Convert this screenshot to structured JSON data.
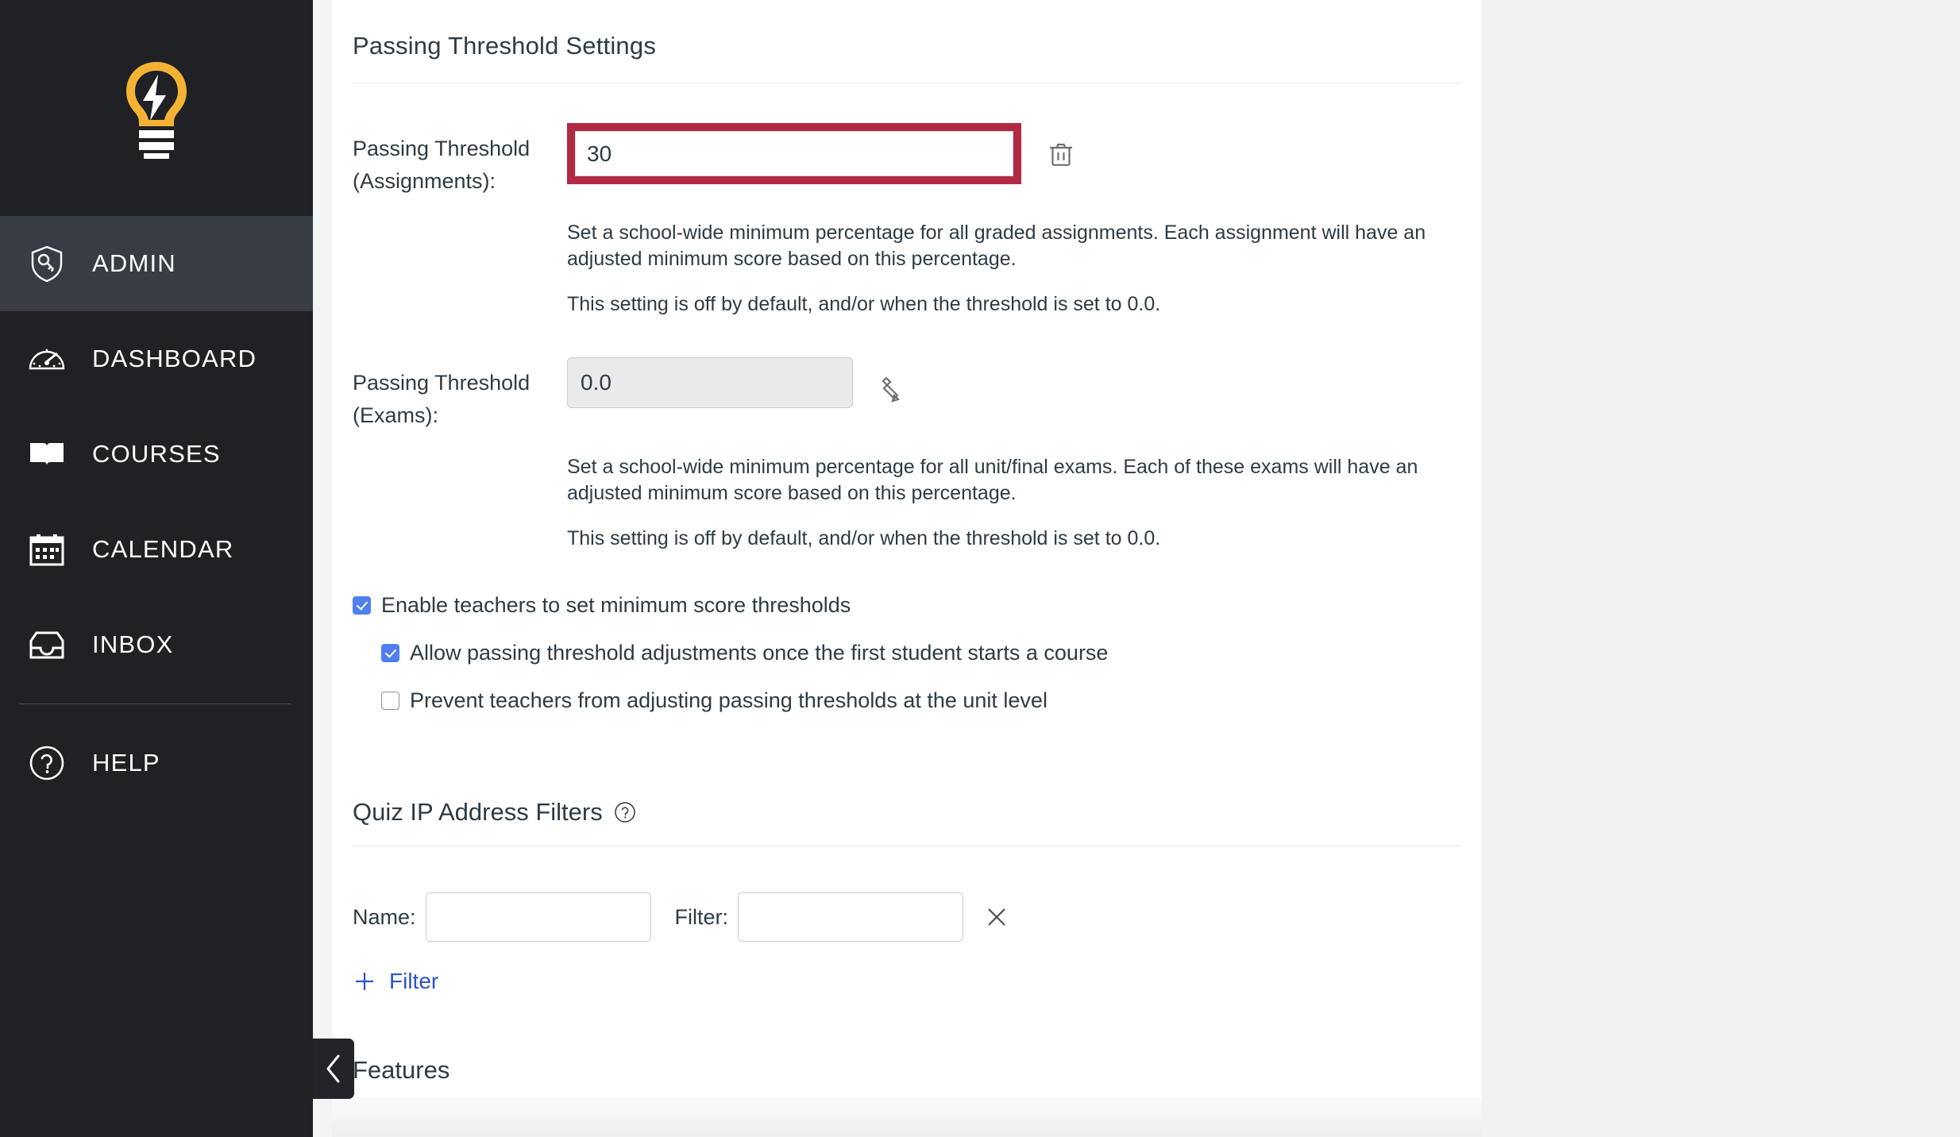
{
  "sidebar": {
    "logo_name": "lightbulb-logo",
    "items": [
      {
        "label": "ADMIN",
        "icon": "shield-key-icon",
        "active": true
      },
      {
        "label": "DASHBOARD",
        "icon": "speedometer-icon",
        "active": false
      },
      {
        "label": "COURSES",
        "icon": "open-book-icon",
        "active": false
      },
      {
        "label": "CALENDAR",
        "icon": "calendar-icon",
        "active": false
      },
      {
        "label": "INBOX",
        "icon": "inbox-tray-icon",
        "active": false
      }
    ],
    "help": {
      "label": "HELP",
      "icon": "question-circle-icon"
    },
    "collapse_icon": "chevron-left-icon"
  },
  "main": {
    "section_title": "Passing Threshold Settings",
    "assignments": {
      "label": "Passing Threshold (Assignments):",
      "value": "30",
      "placeholder": "",
      "action_icon": "trash-icon",
      "desc_1": "Set a school-wide minimum percentage for all graded assignments. Each assignment will have an adjusted minimum score based on this percentage.",
      "desc_2": "This setting is off by default, and/or when the threshold is set to 0.0."
    },
    "exams": {
      "label": "Passing Threshold (Exams):",
      "value": "0.0",
      "placeholder": "",
      "action_icon": "pencil-icon",
      "desc_1": "Set a school-wide minimum percentage for all unit/final exams. Each of these exams will have an adjusted minimum score based on this percentage.",
      "desc_2": "This setting is off by default, and/or when the threshold is set to 0.0."
    },
    "checkboxes": [
      {
        "label": "Enable teachers to set minimum score thresholds",
        "checked": true,
        "indent": false
      },
      {
        "label": "Allow passing threshold adjustments once the first student starts a course",
        "checked": true,
        "indent": true
      },
      {
        "label": "Prevent teachers from adjusting passing thresholds at the unit level",
        "checked": false,
        "indent": true
      }
    ],
    "quiz_ip": {
      "title": "Quiz IP Address Filters",
      "help_icon": "question-circle-icon",
      "name_label": "Name:",
      "name_value": "",
      "name_placeholder": "",
      "filter_label": "Filter:",
      "filter_value": "",
      "filter_placeholder": "",
      "remove_icon": "close-x-icon",
      "add_icon": "plus-icon",
      "add_label": "Filter"
    },
    "features_title": "Features"
  },
  "colors": {
    "sidebar_bg": "#1f2125",
    "sidebar_active": "#383c44",
    "error_crimson": "#b12a43",
    "checkbox_blue": "#4f7ff0",
    "link_blue": "#2b55c4",
    "text": "#2d3b45",
    "logo_yellow": "#f5b335"
  }
}
